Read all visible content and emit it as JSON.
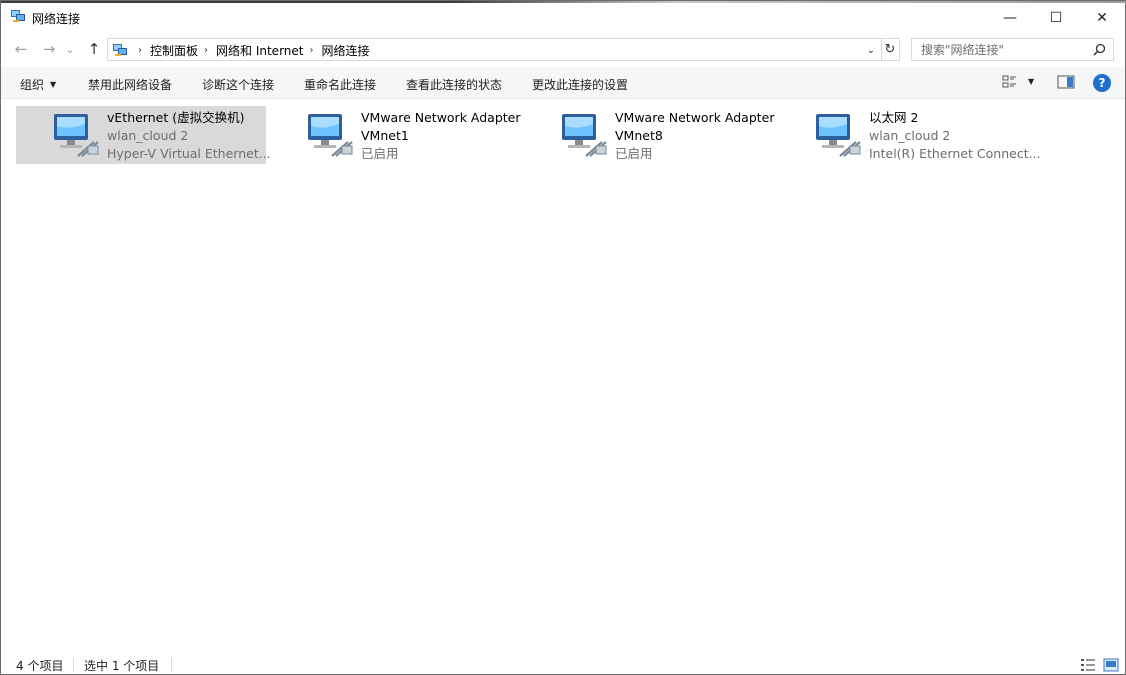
{
  "window": {
    "title": "网络连接",
    "buttons": {
      "minimize": "—",
      "maximize": "☐",
      "close": "✕"
    }
  },
  "address": {
    "breadcrumbs": [
      "控制面板",
      "网络和 Internet",
      "网络连接"
    ],
    "search_placeholder": "搜索\"网络连接\""
  },
  "nav": {
    "back": "←",
    "forward": "→",
    "recent": "⌄",
    "up": "↑",
    "refresh": "↻",
    "dropdown": "⌄"
  },
  "commands": {
    "organize": "组织",
    "disable": "禁用此网络设备",
    "diagnose": "诊断这个连接",
    "rename": "重命名此连接",
    "view_status": "查看此连接的状态",
    "change_settings": "更改此连接的设置"
  },
  "help": "?",
  "connections": [
    {
      "name": "vEthernet (虚拟交换机)",
      "status": "wlan_cloud 2",
      "device": "Hyper-V Virtual Ethernet...",
      "selected": true
    },
    {
      "name": "VMware Network Adapter",
      "status": "VMnet1",
      "device": "已启用",
      "selected": false
    },
    {
      "name": "VMware Network Adapter",
      "status": "VMnet8",
      "device": "已启用",
      "selected": false
    },
    {
      "name": "以太网 2",
      "status": "wlan_cloud 2",
      "device": "Intel(R) Ethernet Connect...",
      "selected": false
    }
  ],
  "statusbar": {
    "item_count": "4 个项目",
    "selected_count": "选中 1 个项目"
  },
  "colors": {
    "selection": "#d9d9d9",
    "command_bar": "#f5f6f7",
    "help_blue": "#1f6fce",
    "secondary_text": "#6d6d6d"
  }
}
